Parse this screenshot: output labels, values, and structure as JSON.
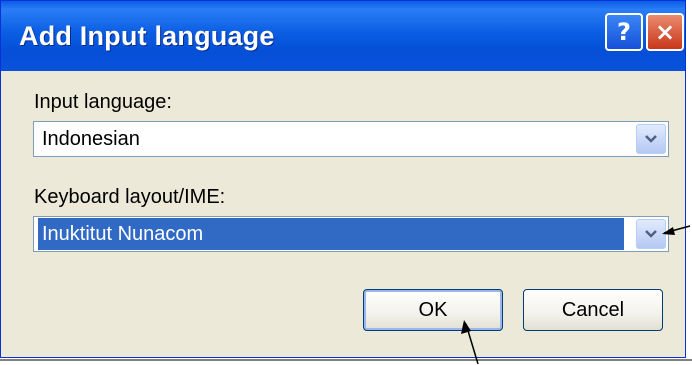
{
  "dialog": {
    "title": "Add Input language",
    "help_glyph": "?",
    "close_glyph": "×"
  },
  "input_language": {
    "label": "Input language:",
    "value": "Indonesian"
  },
  "keyboard_layout": {
    "label": "Keyboard layout/IME:",
    "value": "Inuktitut Nunacom"
  },
  "buttons": {
    "ok": "OK",
    "cancel": "Cancel"
  },
  "colors": {
    "titlebar": "#0a58e0",
    "window_face": "#ece9d8",
    "selection": "#316ac5",
    "close_button": "#d4502f"
  }
}
